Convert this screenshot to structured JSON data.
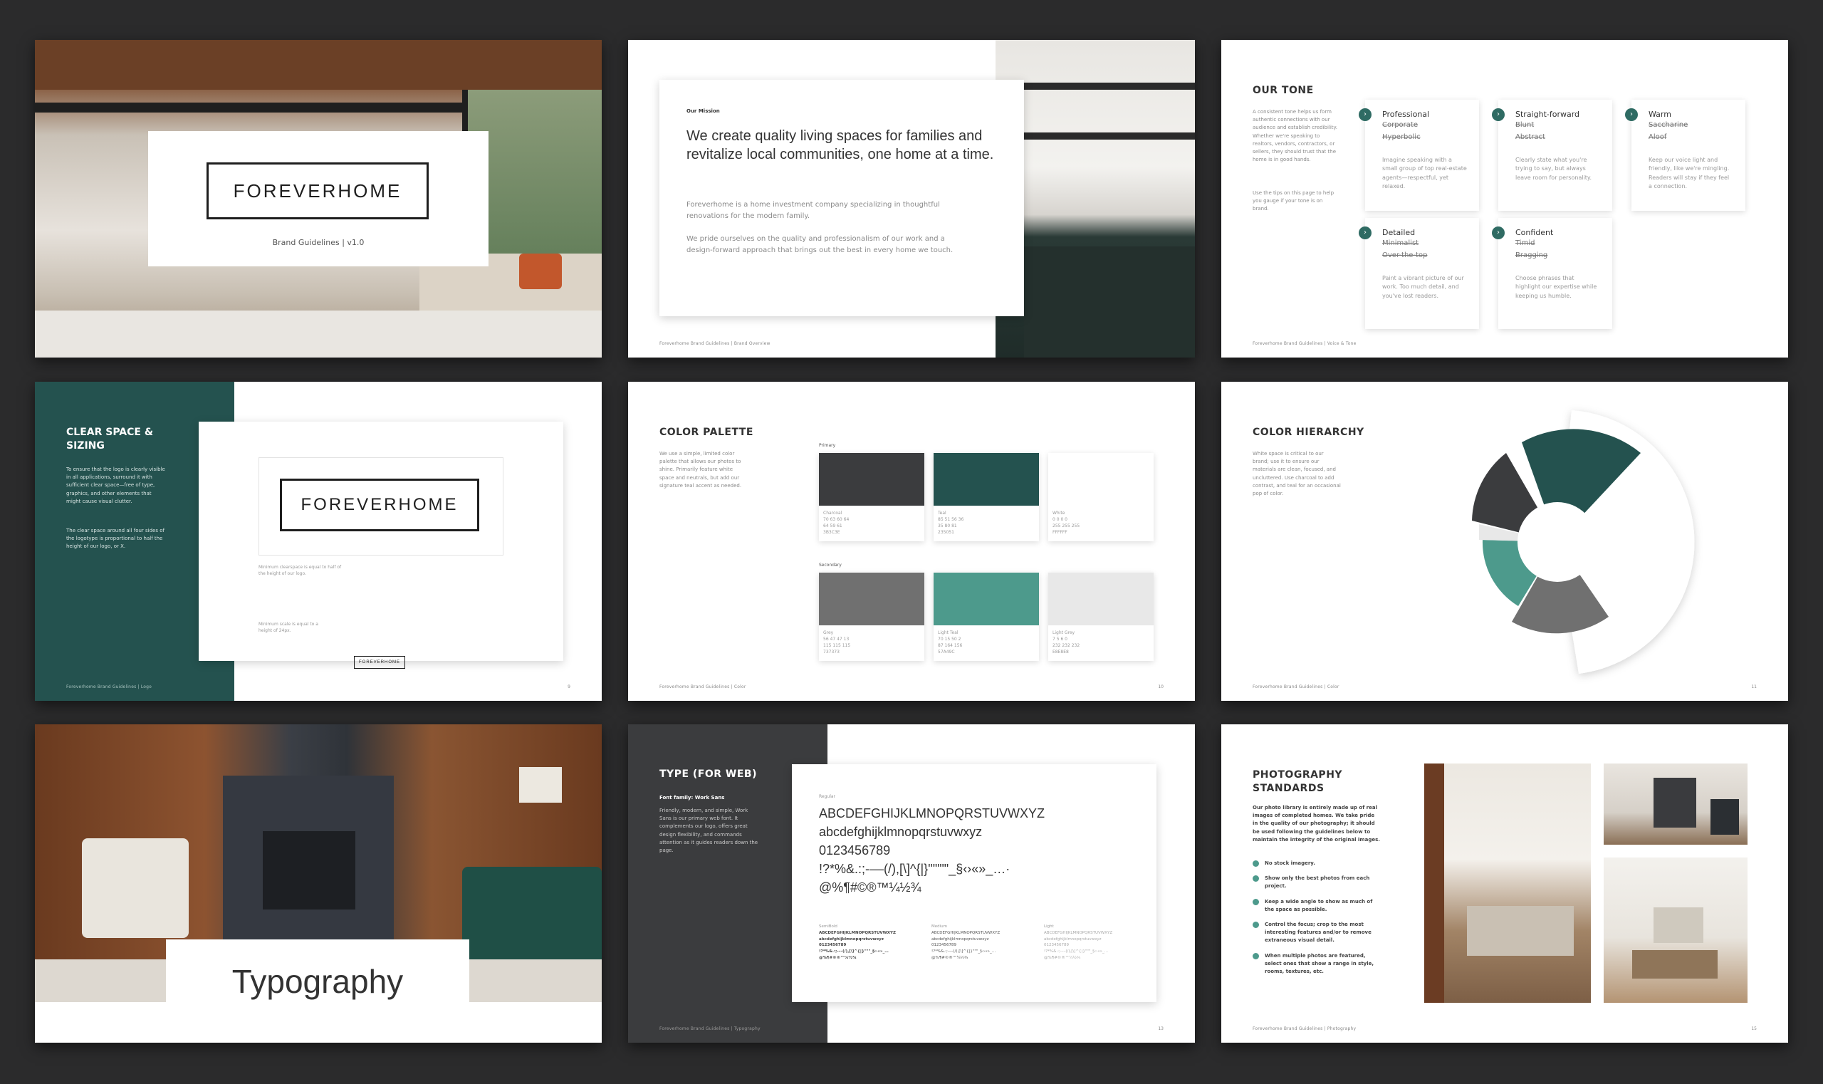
{
  "colors": {
    "background": "#2b2b2c",
    "charcoal": "#3b3c3e",
    "teal": "#24524f",
    "light_teal": "#4d9a8c",
    "grey": "#707070",
    "light_grey": "#e8e8e8"
  },
  "cover": {
    "logo": "FOREVERHOME",
    "subtitle": "Brand Guidelines | v1.0"
  },
  "mission": {
    "label": "Our Mission",
    "headline": "We create quality living spaces for families and revitalize local communities, one home at a time.",
    "para1": "Foreverhome is a home investment company specializing in thoughtful renovations for the modern family.",
    "para2": "We pride ourselves on the quality and professionalism of our work and a design-forward approach that brings out the best in every home we touch.",
    "footer": "Foreverhome Brand Guidelines | Brand Overview"
  },
  "tone": {
    "title": "OUR TONE",
    "intro": "A consistent tone helps us form authentic connections with our audience and establish credibility. Whether we're speaking to realtors, vendors, contractors, or sellers, they should trust that the home is in good hands.",
    "intro2": "Use the tips on this page to help you gauge if your tone is on brand.",
    "footer": "Foreverhome Brand Guidelines | Voice & Tone",
    "cards": [
      {
        "heading": "Professional",
        "strike1": "Corporate",
        "strike2": "Hyperbolic",
        "desc": "Imagine speaking with a small group of top real-estate agents—respectful, yet relaxed."
      },
      {
        "heading": "Straight-forward",
        "strike1": "Blunt",
        "strike2": "Abstract",
        "desc": "Clearly state what you're trying to say, but always leave room for personality."
      },
      {
        "heading": "Warm",
        "strike1": "Saccharine",
        "strike2": "Aloof",
        "desc": "Keep our voice light and friendly, like we're mingling. Readers will stay if they feel a connection."
      },
      {
        "heading": "Detailed",
        "strike1": "Minimalist",
        "strike2": "Over-the-top",
        "desc": "Paint a vibrant picture of our work. Too much detail, and you've lost readers."
      },
      {
        "heading": "Confident",
        "strike1": "Timid",
        "strike2": "Bragging",
        "desc": "Choose phrases that highlight our expertise while keeping us humble."
      }
    ]
  },
  "clearspace": {
    "title": "CLEAR SPACE & SIZING",
    "para1": "To ensure that the logo is clearly visible in all applications, surround it with sufficient clear space—free of type, graphics, and other elements that might cause visual clutter.",
    "para2": "The clear space around all four sides of the logotype is proportional to half the height of our logo, or X.",
    "logo": "FOREVERHOME",
    "note1": "Minimum clearspace is equal to half of the height of our logo.",
    "note2": "Minimum scale is equal to a height of 24px.",
    "small_logo": "FOREVERHOME",
    "footer": "Foreverhome Brand Guidelines | Logo",
    "page": "9"
  },
  "palette": {
    "title": "COLOR PALETTE",
    "intro": "We use a simple, limited color palette that allows our photos to shine. Primarily feature white space and neutrals, but add our signature teal accent as needed.",
    "primary_label": "Primary",
    "secondary_label": "Secondary",
    "footer": "Foreverhome Brand Guidelines | Color",
    "page": "10",
    "primary": [
      {
        "name": "Charcoal",
        "rgb": "70 63 60 64",
        "hex_line": "64 59 61",
        "hex": "3B3C3E",
        "color": "#3b3c3e"
      },
      {
        "name": "Teal",
        "rgb": "85 51 56 36",
        "hex_line": "35 80 81",
        "hex": "235051",
        "color": "#24524f"
      },
      {
        "name": "White",
        "rgb": "0 0 0 0",
        "hex_line": "255 255 255",
        "hex": "FFFFFF",
        "color": "#ffffff"
      }
    ],
    "secondary": [
      {
        "name": "Grey",
        "rgb": "56 47 47 13",
        "hex_line": "115 115 115",
        "hex": "737373",
        "color": "#707070"
      },
      {
        "name": "Light Teal",
        "rgb": "70 15 50 2",
        "hex_line": "87 164 156",
        "hex": "57A49C",
        "color": "#4d9a8c"
      },
      {
        "name": "Light Grey",
        "rgb": "7 5 6 0",
        "hex_line": "232 232 232",
        "hex": "E8E8E8",
        "color": "#e8e8e8"
      }
    ]
  },
  "hierarchy": {
    "title": "COLOR HIERARCHY",
    "intro": "White space is critical to our brand; use it to ensure our materials are clean, focused, and uncluttered. Use charcoal to add contrast, and teal for an occasional pop of color.",
    "footer": "Foreverhome Brand Guidelines | Color",
    "page": "11"
  },
  "typography_cover": {
    "title": "Typography"
  },
  "typeweb": {
    "title": "TYPE (FOR WEB)",
    "font_family": "Font family: Work Sans",
    "intro": "Friendly, modern, and simple, Work Sans is our primary web font. It complements our logo, offers great design flexibility, and commands attention as it guides readers down the page.",
    "regular_label": "Regular",
    "upper": "ABCDEFGHIJKLMNOPQRSTUVWXYZ",
    "lower": "abcdefghijklmnopqrstuvwxyz",
    "digits": "0123456789",
    "symbols1": "!?*%&.:;-––(/),[\\]^{|}'\"\"\"\"_§‹›«»_…·",
    "symbols2": "@%¶#©®™¼½¾",
    "weights": [
      {
        "label": "SemiBold",
        "upper": "ABCDEFGHIJKLMNOPQRSTUVWXYZ",
        "lower": "abcdefghijklmnopqrstuvwxyz",
        "digits": "0123456789",
        "sym1": "!?*%&.:;-––(/),[\\]^{|}\"\"\"_§‹›«»_…",
        "sym2": "@%¶#©®™¼½¾"
      },
      {
        "label": "Medium",
        "upper": "ABCDEFGHIJKLMNOPQRSTUVWXYZ",
        "lower": "abcdefghijklmnopqrstuvwxyz",
        "digits": "0123456789",
        "sym1": "!?*%&.:;-––(/),[\\]^{|}\"\"\"_§‹›«»_…",
        "sym2": "@%¶#©®™¼½¾"
      },
      {
        "label": "Light",
        "upper": "ABCDEFGHIJKLMNOPQRSTUVWXYZ",
        "lower": "abcdefghijklmnopqrstuvwxyz",
        "digits": "0123456789",
        "sym1": "!?*%&.:;-––(/),[\\]^{|}\"\"\"_§‹›«»_…",
        "sym2": "@%¶#©®™¼½¾"
      }
    ],
    "footer": "Foreverhome Brand Guidelines | Typography",
    "page": "13"
  },
  "photography": {
    "title": "PHOTOGRAPHY STANDARDS",
    "intro": "Our photo library is entirely made up of real images of completed homes. We take pride in the quality of our photography; it should be used following the guidelines below to maintain the integrity of the original images.",
    "rules": [
      "No stock imagery.",
      "Show only the best photos from each project.",
      "Keep a wide angle to show as much of the space as possible.",
      "Control the focus; crop to the most interesting features and/or to remove extraneous visual detail.",
      "When multiple photos are featured, select ones that show a range in style, rooms, textures, etc."
    ],
    "footer": "Foreverhome Brand Guidelines | Photography",
    "page": "15"
  }
}
